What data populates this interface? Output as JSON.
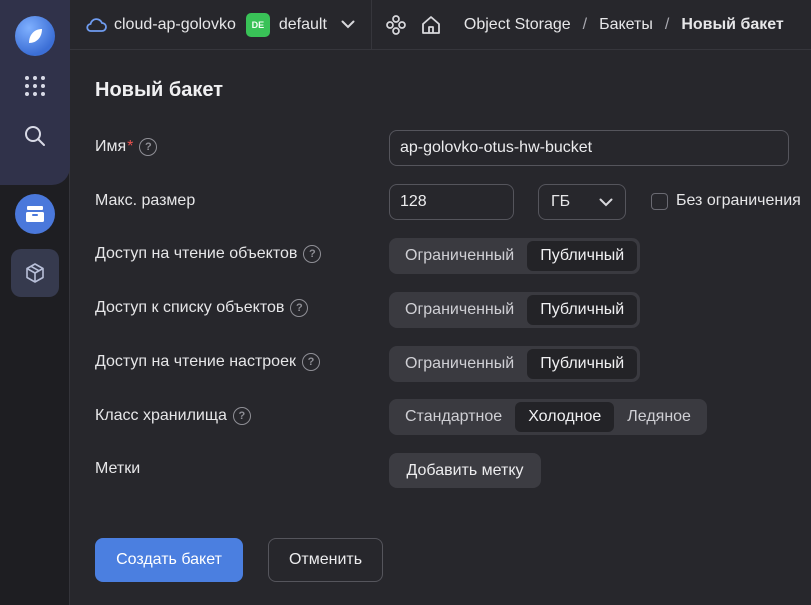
{
  "header": {
    "cloud_name": "cloud-ap-golovko",
    "folder_badge": "DE",
    "folder_name": "default",
    "breadcrumbs": [
      "Object Storage",
      "Бакеты",
      "Новый бакет"
    ],
    "separator": "/"
  },
  "colors": {
    "accent": "#4b7fe0",
    "badge": "#39c257",
    "required": "#f0524f"
  },
  "form": {
    "title": "Новый бакет",
    "name": {
      "label": "Имя",
      "required_mark": "*",
      "value": "ap-golovko-otus-hw-bucket"
    },
    "max_size": {
      "label": "Макс. размер",
      "value": "128",
      "unit": "ГБ",
      "unlimited_label": "Без ограничения",
      "unlimited_checked": false
    },
    "read_access": {
      "label": "Доступ на чтение объектов",
      "options": [
        "Ограниченный",
        "Публичный"
      ],
      "selected": "Публичный"
    },
    "list_access": {
      "label": "Доступ к списку объектов",
      "options": [
        "Ограниченный",
        "Публичный"
      ],
      "selected": "Публичный"
    },
    "settings_access": {
      "label": "Доступ на чтение настроек",
      "options": [
        "Ограниченный",
        "Публичный"
      ],
      "selected": "Публичный"
    },
    "storage_class": {
      "label": "Класс хранилища",
      "options": [
        "Стандартное",
        "Холодное",
        "Ледяное"
      ],
      "selected": "Холодное"
    },
    "tags": {
      "label": "Метки",
      "add_button": "Добавить метку"
    },
    "help_glyph": "?",
    "submit_button": "Создать бакет",
    "cancel_button": "Отменить"
  }
}
